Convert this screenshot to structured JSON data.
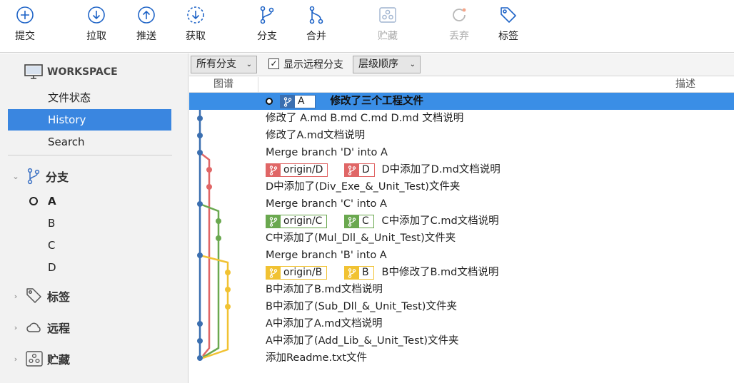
{
  "toolbar": {
    "commit": "提交",
    "pull": "拉取",
    "push": "推送",
    "fetch": "获取",
    "branch": "分支",
    "merge": "合并",
    "stash": "贮藏",
    "discard": "丢弃",
    "tag": "标签"
  },
  "sidebar": {
    "workspace": "WORKSPACE",
    "items": [
      "文件状态",
      "History",
      "Search"
    ],
    "branches_label": "分支",
    "branches": [
      "A",
      "B",
      "C",
      "D"
    ],
    "tags_label": "标签",
    "remotes_label": "远程",
    "stashes_label": "贮藏"
  },
  "filter": {
    "branches_select": "所有分支",
    "show_remote": "显示远程分支",
    "show_remote_checked": true,
    "order_select": "层级顺序"
  },
  "columns": {
    "graph": "图谱",
    "description": "描述"
  },
  "colors": {
    "A": "#3b6fb0",
    "B": "#f1c232",
    "C": "#6aa84f",
    "D": "#e06666",
    "accent": "#3a8ee6"
  },
  "commits": [
    {
      "msg": "修改了三个工程文件",
      "refs": [
        {
          "name": "A",
          "color": "#3b6fb0"
        }
      ]
    },
    {
      "msg": "修改了 A.md B.md C.md D.md 文档说明"
    },
    {
      "msg": "修改了A.md文档说明"
    },
    {
      "msg": "Merge branch 'D' into A"
    },
    {
      "msg": "D中添加了D.md文档说明",
      "refs": [
        {
          "name": "origin/D",
          "color": "#e06666"
        },
        {
          "name": "D",
          "color": "#e06666"
        }
      ]
    },
    {
      "msg": "D中添加了(Div_Exe_&_Unit_Test)文件夹"
    },
    {
      "msg": "Merge branch 'C' into A"
    },
    {
      "msg": "C中添加了C.md文档说明",
      "refs": [
        {
          "name": "origin/C",
          "color": "#6aa84f"
        },
        {
          "name": "C",
          "color": "#6aa84f"
        }
      ]
    },
    {
      "msg": "C中添加了(Mul_Dll_&_Unit_Test)文件夹"
    },
    {
      "msg": "Merge branch 'B' into A"
    },
    {
      "msg": "B中修改了B.md文档说明",
      "refs": [
        {
          "name": "origin/B",
          "color": "#f1c232"
        },
        {
          "name": "B",
          "color": "#f1c232"
        }
      ]
    },
    {
      "msg": "B中添加了B.md文档说明"
    },
    {
      "msg": "B中添加了(Sub_Dll_&_Unit_Test)文件夹"
    },
    {
      "msg": "A中添加了A.md文档说明"
    },
    {
      "msg": "A中添加了(Add_Lib_&_Unit_Test)文件夹"
    },
    {
      "msg": "添加Readme.txt文件"
    }
  ]
}
